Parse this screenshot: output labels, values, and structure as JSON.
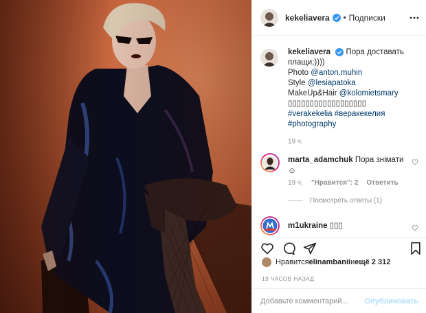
{
  "header": {
    "username": "kekeliavera",
    "separator": "•",
    "follow_label": "Подписки"
  },
  "caption": {
    "username": "kekeliavera",
    "line1": "Пора доставать плащи;))))",
    "photo_prefix": "Photo ",
    "photo_link": "@anton.muhin",
    "style_prefix": "Style ",
    "style_link": "@lesiapatoka",
    "makeup_prefix": "MakeUp&Hair ",
    "makeup_link": "@kolomietsmary",
    "symbols": "▯▯▯▯▯▯▯▯▯▯▯▯▯▯▯▯▯▯",
    "tag1": "#verakekelia",
    "tag2": "#веракекелия",
    "tag3": "#photography",
    "time": "19 ч."
  },
  "comment1": {
    "username": "marta_adamchuk",
    "text": "Пора знімати",
    "emoji": "☺",
    "time": "19 ч.",
    "likes": "\"Нравится\": 2",
    "reply": "Ответить",
    "view_replies": "Посмотреть ответы (1)"
  },
  "comment2": {
    "username": "m1ukraine",
    "text": "▯▯▯"
  },
  "likes": {
    "prefix": "Нравится ",
    "user": "elinambanii",
    "middle": " и ",
    "count": "ещё 2 312"
  },
  "timestamp": "19 ЧАСОВ НАЗАД",
  "add_comment": {
    "placeholder": "Добавьте комментарий...",
    "post_label": "Опубликовать"
  },
  "icons": [
    "verified-icon",
    "more-options-icon",
    "heart-icon",
    "comment-icon",
    "share-icon",
    "bookmark-icon"
  ],
  "colors": {
    "verified": "#3897f0",
    "link": "#00376b",
    "post_button": "#b2dffc",
    "muted": "#8e8e8e"
  }
}
